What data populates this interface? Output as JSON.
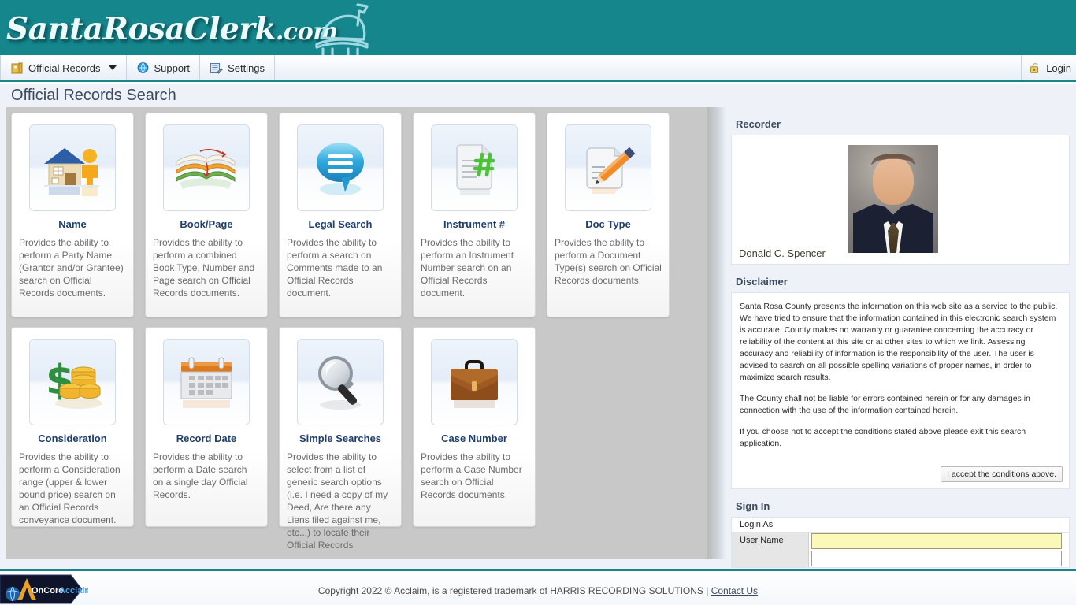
{
  "brand": {
    "name_part1": "SantaRosa",
    "name_part2": "Clerk",
    "dotcom": ".com",
    "logo_icon": "bench-outline-logo",
    "banner_color": "#14868c"
  },
  "nav": {
    "items": [
      {
        "label": "Official Records",
        "icon": "records-box-icon",
        "has_caret": true
      },
      {
        "label": "Support",
        "icon": "help-globe-icon",
        "has_caret": false
      },
      {
        "label": "Settings",
        "icon": "settings-wrench-icon",
        "has_caret": false
      }
    ],
    "login": {
      "label": "Login",
      "icon": "unlock-padlock-icon"
    }
  },
  "page": {
    "title": "Official Records Search"
  },
  "cards": [
    {
      "title": "Name",
      "icon": "house-and-person-icon",
      "desc": "Provides the ability to perform a Party Name (Grantor and/or Grantee) search on Official Records documents."
    },
    {
      "title": "Book/Page",
      "icon": "stack-of-books-icon",
      "desc": "Provides the ability to perform a combined Book Type, Number and Page search on Official Records documents."
    },
    {
      "title": "Legal Search",
      "icon": "speech-bubble-icon",
      "desc": "Provides the ability to perform a search on Comments made to an Official Records document."
    },
    {
      "title": "Instrument #",
      "icon": "document-hash-icon",
      "desc": "Provides the ability to perform an Instrument Number search on an Official Records document."
    },
    {
      "title": "Doc Type",
      "icon": "document-pencil-icon",
      "desc": "Provides the ability to perform a Document Type(s) search on Official Records documents."
    },
    {
      "title": "Consideration",
      "icon": "dollar-coins-icon",
      "desc": "Provides the ability to perform a Consideration range (upper & lower bound price) search on an Official Records conveyance document."
    },
    {
      "title": "Record Date",
      "icon": "calendar-icon",
      "desc": "Provides the ability to perform a Date search on a single day Official Records."
    },
    {
      "title": "Simple Searches",
      "icon": "magnifying-glass-icon",
      "desc": "Provides the ability to select from a list of generic search options (i.e. I need a copy of my Deed, Are there any Liens filed against me, etc...) to locate their Official Records"
    },
    {
      "title": "Case Number",
      "icon": "briefcase-icon",
      "desc": "Provides the ability to perform a Case Number search on Official Records documents."
    }
  ],
  "sidebar": {
    "recorder": {
      "heading": "Recorder",
      "name": "Donald C. Spencer",
      "photo_alt": "recorder-portrait"
    },
    "disclaimer": {
      "heading": "Disclaimer",
      "paragraphs": [
        "Santa Rosa County presents the information on this web site as a service to the public. We have tried to ensure that the information contained in this electronic search system is accurate. County makes no warranty or guarantee concerning the accuracy or reliability of the content at this site or at other sites to which we link. Assessing accuracy and reliability of information is the responsibility of the user. The user is advised to search on all possible spelling variations of proper names, in order to maximize search results.",
        "The County shall not be liable for errors contained herein or for any damages in connection with the use of the information contained herein.",
        "If you choose not to accept the conditions stated above please exit this search application."
      ],
      "accept_label": "I accept the conditions above."
    },
    "signin": {
      "heading": "Sign In",
      "login_as_label": "Login As",
      "username_label": "User Name",
      "username_value": "",
      "username_bg": "#fbf8b8"
    }
  },
  "footer": {
    "logo_text_1": "OnCore",
    "logo_text_2": "Acclaim",
    "copyright": "Copyright 2022 © Acclaim, is a registered trademark of HARRIS RECORDING SOLUTIONS | ",
    "contact_link": "Contact Us"
  }
}
